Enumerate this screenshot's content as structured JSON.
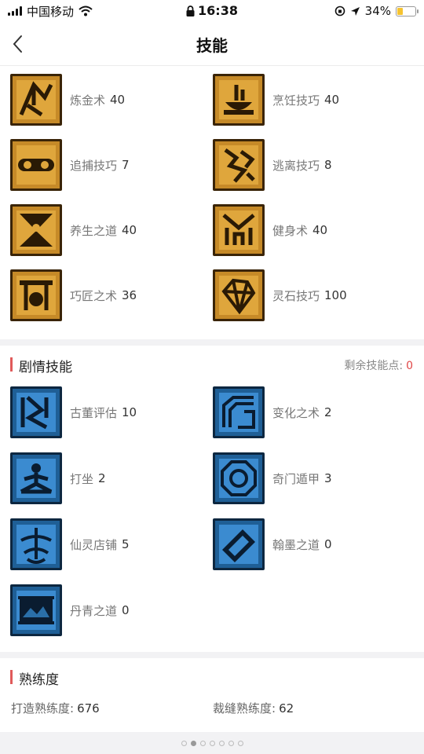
{
  "status_bar": {
    "carrier": "中国移动",
    "time": "16:38",
    "battery": "34%",
    "battery_level": 0.34
  },
  "nav": {
    "title": "技能"
  },
  "life_skills": [
    {
      "name": "炼金术",
      "level": "40",
      "icon": "alchemy-icon"
    },
    {
      "name": "烹饪技巧",
      "level": "40",
      "icon": "cooking-icon"
    },
    {
      "name": "追捕技巧",
      "level": "7",
      "icon": "pursuit-icon"
    },
    {
      "name": "逃离技巧",
      "level": "8",
      "icon": "escape-icon"
    },
    {
      "name": "养生之道",
      "level": "40",
      "icon": "health-icon"
    },
    {
      "name": "健身术",
      "level": "40",
      "icon": "fitness-icon"
    },
    {
      "name": "巧匠之术",
      "level": "36",
      "icon": "craftsman-icon"
    },
    {
      "name": "灵石技巧",
      "level": "100",
      "icon": "spirit-stone-icon"
    }
  ],
  "story_section": {
    "title": "剧情技能",
    "points_label": "剩余技能点:",
    "points": "0"
  },
  "story_skills": [
    {
      "name": "古董评估",
      "level": "10",
      "icon": "antique-icon"
    },
    {
      "name": "变化之术",
      "level": "2",
      "icon": "transform-icon"
    },
    {
      "name": "打坐",
      "level": "2",
      "icon": "meditate-icon"
    },
    {
      "name": "奇门遁甲",
      "level": "3",
      "icon": "qimen-icon"
    },
    {
      "name": "仙灵店铺",
      "level": "5",
      "icon": "shop-icon"
    },
    {
      "name": "翰墨之道",
      "level": "0",
      "icon": "ink-icon"
    },
    {
      "name": "丹青之道",
      "level": "0",
      "icon": "painting-icon"
    }
  ],
  "proficiency": {
    "title": "熟练度",
    "items": [
      {
        "label": "打造熟练度:",
        "value": "676"
      },
      {
        "label": "裁缝熟练度:",
        "value": "62"
      }
    ]
  },
  "colors": {
    "accent": "#e05a5a",
    "gold": "#c9922b",
    "blue": "#2e7fc0"
  },
  "pager": {
    "count": 7,
    "active": 1
  }
}
